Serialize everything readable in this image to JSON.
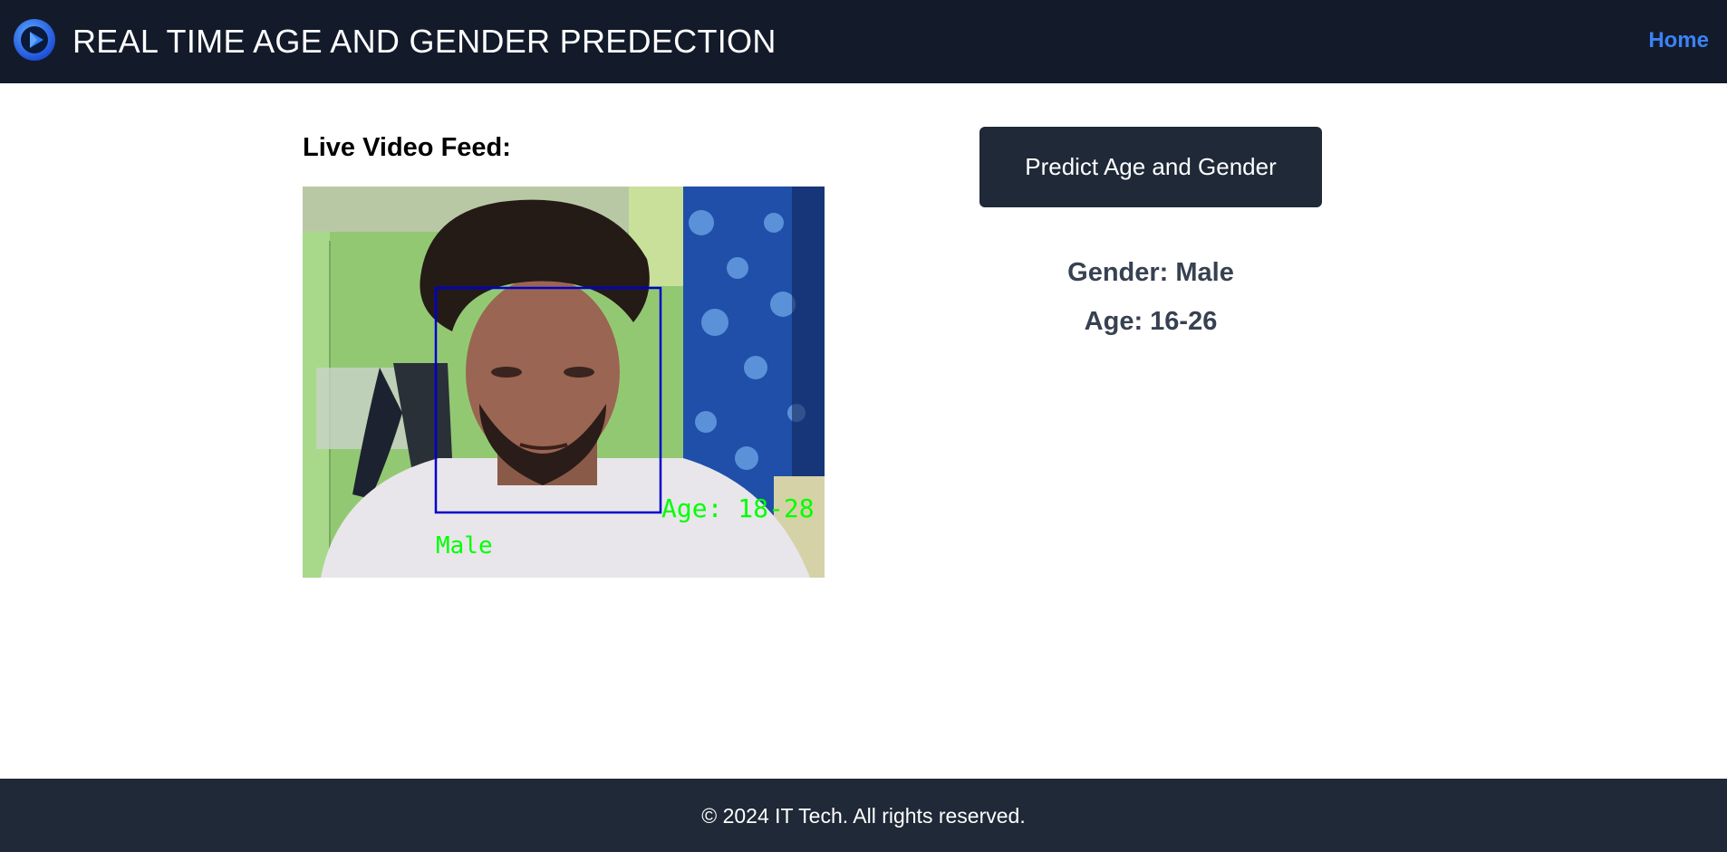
{
  "header": {
    "title": "REAL TIME AGE AND GENDER PREDECTION",
    "nav": {
      "home_label": "Home"
    },
    "logo_icon": "play-circle-logo-icon"
  },
  "main": {
    "feed_heading": "Live Video Feed:",
    "video_overlay": {
      "age_text": "Age: 18-28",
      "gender_text": "Male"
    },
    "predict_button_label": "Predict Age and Gender",
    "results": {
      "gender": "Gender: Male",
      "age": "Age: 16-26"
    }
  },
  "footer": {
    "copyright": "© 2024 IT Tech. All rights reserved."
  },
  "colors": {
    "header_bg": "#131a2a",
    "footer_bg": "#1f2937",
    "button_bg": "#1f2937",
    "nav_link": "#3b82f6",
    "result_text": "#374151",
    "face_box": "#0000cc",
    "overlay_text": "#00ff00"
  }
}
